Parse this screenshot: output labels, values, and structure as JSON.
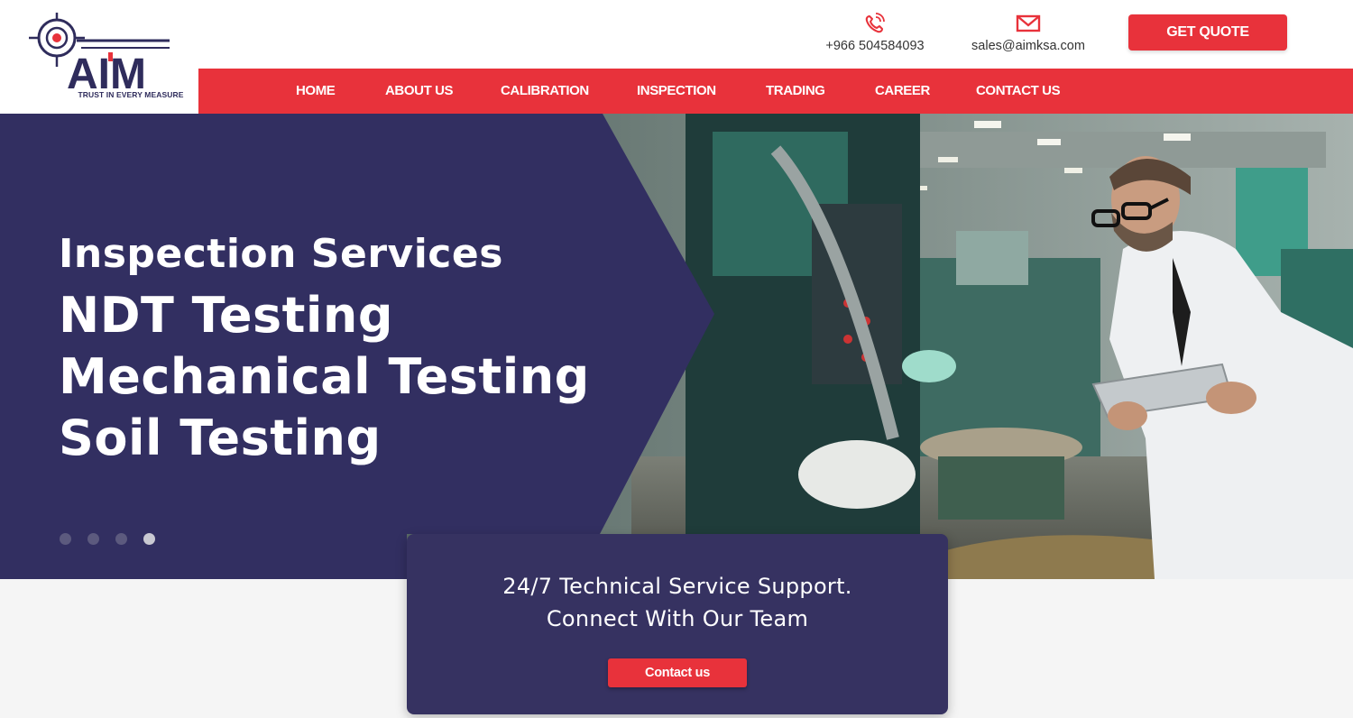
{
  "brand": {
    "logo_text": "AIM",
    "tagline": "TRUST IN EVERY MEASURE",
    "primary_color": "#e8323b",
    "navy_color": "#2f2c5c"
  },
  "header": {
    "phone": "+966 504584093",
    "email": "sales@aimksa.com",
    "quote_button": "GET QUOTE"
  },
  "nav": {
    "items": [
      {
        "label": "HOME"
      },
      {
        "label": "ABOUT US"
      },
      {
        "label": "CALIBRATION"
      },
      {
        "label": "INSPECTION"
      },
      {
        "label": "TRADING"
      },
      {
        "label": "CAREER"
      },
      {
        "label": "CONTACT US"
      }
    ]
  },
  "hero": {
    "lines": [
      "Inspection Services",
      "NDT Testing",
      "Mechanical Testing",
      "Soil Testing"
    ],
    "slides_total": 4,
    "active_slide": 4
  },
  "support": {
    "line1": "24/7 Technical Service Support.",
    "line2": "Connect With Our Team",
    "button": "Contact us"
  }
}
